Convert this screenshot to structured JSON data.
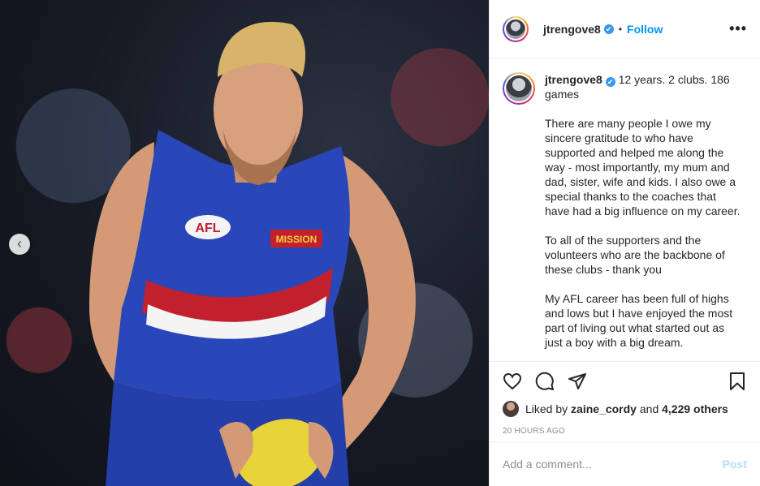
{
  "post": {
    "username": "jtrengove8",
    "follow_label": "Follow",
    "more_label": "•••",
    "dot": "•",
    "carousel_prev": "‹",
    "verified_glyph": "✔"
  },
  "caption": {
    "username": "jtrengove8",
    "title": "12 years. 2 clubs. 186 games",
    "paragraphs": [
      "There are many people I owe my sincere gratitude to who have supported and helped me along the way - most importantly, my mum and dad, sister, wife and kids. I also owe a special thanks to the coaches that have had a big influence on my career.",
      "To all of the supporters and the volunteers who are the backbone of these clubs - thank you",
      "My AFL career has been full of highs and lows but I have enjoyed the most part of living out what started out as just a boy with a big dream."
    ]
  },
  "photo": {
    "afl_logo": "AFL",
    "sponsor": "MISSION"
  },
  "likes": {
    "prefix": "Liked by",
    "user": "zaine_cordy",
    "middle": "and",
    "count": "4,229 others"
  },
  "timestamp": "20 HOURS AGO",
  "comment": {
    "placeholder": "Add a comment...",
    "post_label": "Post"
  },
  "icons": {
    "like": "heart-icon",
    "comment": "comment-icon",
    "share": "share-icon",
    "save": "bookmark-icon"
  },
  "colors": {
    "link": "#0095f6",
    "post_disabled": "#b2dffc",
    "jersey": "#2947b8",
    "stripe_red": "#c2202d"
  }
}
